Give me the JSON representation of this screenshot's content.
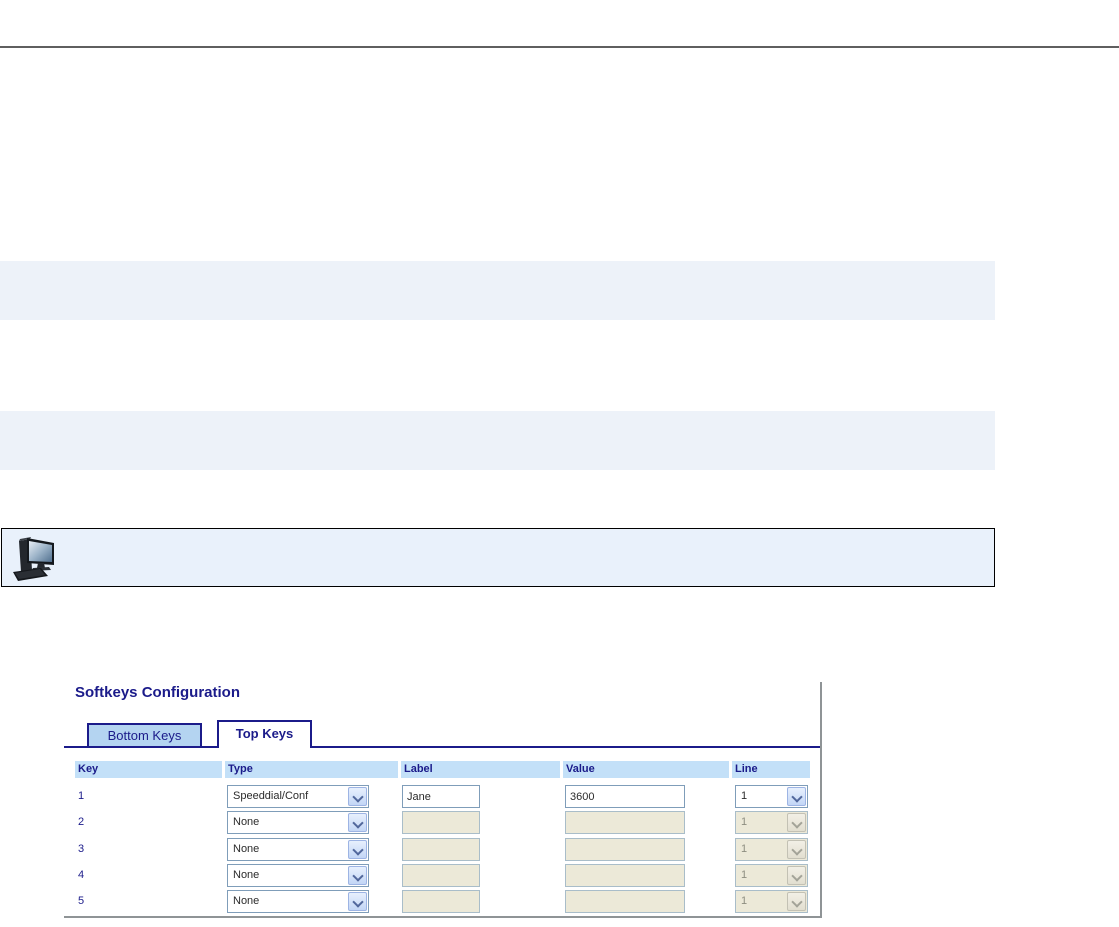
{
  "figure": {
    "title": "Softkeys Configuration",
    "tabs": [
      {
        "label": "Bottom Keys",
        "active": false
      },
      {
        "label": "Top Keys",
        "active": true
      }
    ],
    "table": {
      "headers": [
        "Key",
        "Type",
        "Label",
        "Value",
        "Line"
      ],
      "rows": [
        {
          "key": "1",
          "type": "Speeddial/Conf",
          "label": "Jane",
          "value": "3600",
          "line": "1",
          "enabled": true
        },
        {
          "key": "2",
          "type": "None",
          "label": "",
          "value": "",
          "line": "1",
          "enabled": false
        },
        {
          "key": "3",
          "type": "None",
          "label": "",
          "value": "",
          "line": "1",
          "enabled": false
        },
        {
          "key": "4",
          "type": "None",
          "label": "",
          "value": "",
          "line": "1",
          "enabled": false
        },
        {
          "key": "5",
          "type": "None",
          "label": "",
          "value": "",
          "line": "1",
          "enabled": false
        }
      ]
    }
  },
  "note": {
    "icon": "computer-icon"
  },
  "colors": {
    "navy": "#1b1b8a",
    "header_bg": "#c3e0f8",
    "inactive_tab_bg": "#b4d4f1",
    "band_bg": "#edf2f9",
    "note_bg": "#e9f1fb",
    "top_rule": "#5f5f5f",
    "figure_border": "#8f9496",
    "field_border": "#7f9db9",
    "disabled_bg": "#ece9d8"
  }
}
